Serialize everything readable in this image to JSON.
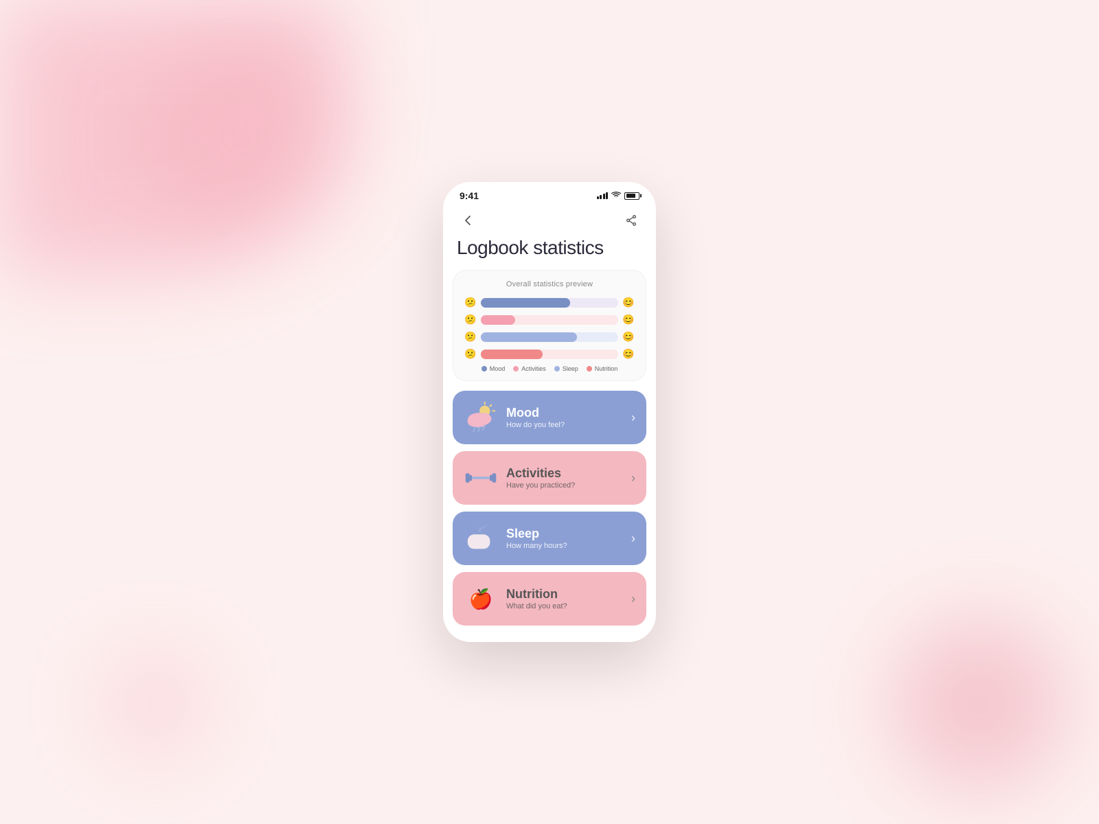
{
  "background": {
    "color": "#fdf0f0"
  },
  "phone": {
    "status_bar": {
      "time": "9:41",
      "signal_alt": "signal bars",
      "wifi_alt": "wifi",
      "battery_alt": "battery"
    },
    "nav": {
      "back_label": "←",
      "share_label": "share"
    },
    "page_title": "Logbook statistics",
    "stats_card": {
      "title": "Overall statistics preview",
      "rows": [
        {
          "left_emoji": "😕",
          "right_emoji": "😊",
          "fill_pct": 65,
          "bg_color": "#f0e8f5",
          "fill_color": "#8b9fd4"
        },
        {
          "left_emoji": "😕",
          "right_emoji": "😊",
          "fill_pct": 25,
          "bg_color": "#fce8e8",
          "fill_color": "#f4a0b0"
        },
        {
          "left_emoji": "😕",
          "right_emoji": "😊",
          "fill_pct": 70,
          "bg_color": "#e8ecf8",
          "fill_color": "#a0b3e0"
        },
        {
          "left_emoji": "😕",
          "right_emoji": "😊",
          "fill_pct": 45,
          "bg_color": "#fce8e8",
          "fill_color": "#f09090"
        }
      ],
      "legend": [
        {
          "label": "Mood",
          "color": "#8b9fd4"
        },
        {
          "label": "Activities",
          "color": "#f4a0b0"
        },
        {
          "label": "Sleep",
          "color": "#a0b3e0"
        },
        {
          "label": "Nutrition",
          "color": "#f09090"
        }
      ]
    },
    "categories": [
      {
        "id": "mood",
        "title": "Mood",
        "subtitle": "How do you feel?",
        "bg_color": "#8b9fd4",
        "icon": "⛈️",
        "chevron": "›"
      },
      {
        "id": "activities",
        "title": "Activities",
        "subtitle": "Have you practiced?",
        "bg_color": "#f4b8c0",
        "icon": "dumbbell",
        "chevron": "›"
      },
      {
        "id": "sleep",
        "title": "Sleep",
        "subtitle": "How many hours?",
        "bg_color": "#8b9fd4",
        "icon": "🛏️",
        "chevron": "›"
      },
      {
        "id": "nutrition",
        "title": "Nutrition",
        "subtitle": "What did you eat?",
        "bg_color": "#f4b8c0",
        "icon": "🍎",
        "chevron": "›"
      }
    ]
  }
}
